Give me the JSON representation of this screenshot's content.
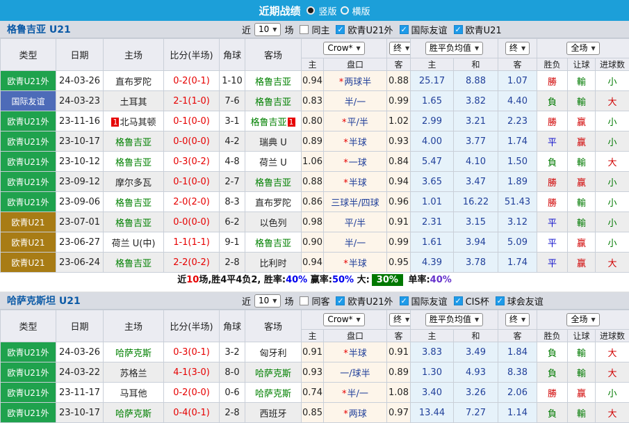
{
  "topbar": {
    "title": "近期战绩",
    "radio_vertical": "竖版",
    "radio_horizontal": "横版"
  },
  "columns": {
    "col_type": "类型",
    "col_date": "日期",
    "col_home": "主场",
    "col_score": "比分(半场)",
    "col_corner": "角球",
    "col_away": "客场",
    "dd_bookmaker": "Crow*",
    "dd_end1": "终",
    "dd_wdl_mean": "胜平负均值",
    "dd_end2": "终",
    "dd_scope": "全场",
    "sub": [
      "主",
      "盘口",
      "客",
      "主",
      "和",
      "客",
      "胜负",
      "让球",
      "进球数"
    ]
  },
  "colors": {
    "topbar_bg": "#1C9FD9",
    "team_title_blue": "#0C5AA6",
    "badge_green": "#1FA24D",
    "badge_blue": "#4D6BB8",
    "badge_brown": "#A87C15",
    "team_green": "#008000",
    "score_red": "#E60000",
    "handicap_navy": "#21409A",
    "result_red": "#D00000",
    "result_green": "#007A00",
    "result_blue": "#1414CC",
    "checkbox_blue": "#1E9BE9",
    "summary_box_green": "#007800"
  },
  "tables": [
    {
      "team": "格鲁吉亚 U21",
      "filter": {
        "near_label": "近",
        "matches_value": "10",
        "matches_label": "场",
        "same_label": "同主",
        "comps": [
          "欧青U21外",
          "国际友谊",
          "欧青U21"
        ]
      },
      "rows": [
        {
          "type": "欧青U21外",
          "type_color": "green",
          "date": "24-03-26",
          "home": "直布罗陀",
          "home_green": false,
          "home_mark": "",
          "score": "0-2(0-1)",
          "corner": "1-10",
          "away": "格鲁吉亚",
          "away_green": true,
          "away_mark": "",
          "o1": "0.94",
          "hc_star": true,
          "hc": "两球半",
          "o2": "0.88",
          "m1": "25.17",
          "m2": "8.88",
          "m3": "1.07",
          "r1": "勝",
          "r1c": "red",
          "r2": "輸",
          "r2c": "green",
          "r3": "小",
          "r3c": "green"
        },
        {
          "type": "国际友谊",
          "type_color": "blue",
          "date": "24-03-23",
          "home": "土耳其",
          "home_green": false,
          "home_mark": "",
          "score": "2-1(1-0)",
          "corner": "7-6",
          "away": "格鲁吉亚",
          "away_green": true,
          "away_mark": "",
          "o1": "0.83",
          "hc_star": false,
          "hc": "半/一",
          "o2": "0.99",
          "m1": "1.65",
          "m2": "3.82",
          "m3": "4.40",
          "r1": "負",
          "r1c": "green",
          "r2": "輸",
          "r2c": "green",
          "r3": "大",
          "r3c": "red"
        },
        {
          "type": "欧青U21外",
          "type_color": "green",
          "date": "23-11-16",
          "home": "北马其顿",
          "home_green": false,
          "home_mark": "1",
          "score": "0-1(0-0)",
          "corner": "3-1",
          "away": "格鲁吉亚",
          "away_green": true,
          "away_mark": "1",
          "o1": "0.80",
          "hc_star": true,
          "hc": "平/半",
          "o2": "1.02",
          "m1": "2.99",
          "m2": "3.21",
          "m3": "2.23",
          "r1": "勝",
          "r1c": "red",
          "r2": "赢",
          "r2c": "red",
          "r3": "小",
          "r3c": "green"
        },
        {
          "type": "欧青U21外",
          "type_color": "green",
          "date": "23-10-17",
          "home": "格鲁吉亚",
          "home_green": true,
          "home_mark": "",
          "score": "0-0(0-0)",
          "corner": "4-2",
          "away": "瑞典 U",
          "away_green": false,
          "away_mark": "",
          "o1": "0.89",
          "hc_star": true,
          "hc": "半球",
          "o2": "0.93",
          "m1": "4.00",
          "m2": "3.77",
          "m3": "1.74",
          "r1": "平",
          "r1c": "blue",
          "r2": "赢",
          "r2c": "red",
          "r3": "小",
          "r3c": "green"
        },
        {
          "type": "欧青U21外",
          "type_color": "green",
          "date": "23-10-12",
          "home": "格鲁吉亚",
          "home_green": true,
          "home_mark": "",
          "score": "0-3(0-2)",
          "corner": "4-8",
          "away": "荷兰 U",
          "away_green": false,
          "away_mark": "",
          "o1": "1.06",
          "hc_star": true,
          "hc": "一球",
          "o2": "0.84",
          "m1": "5.47",
          "m2": "4.10",
          "m3": "1.50",
          "r1": "負",
          "r1c": "green",
          "r2": "輸",
          "r2c": "green",
          "r3": "大",
          "r3c": "red"
        },
        {
          "type": "欧青U21外",
          "type_color": "green",
          "date": "23-09-12",
          "home": "摩尔多瓦",
          "home_green": false,
          "home_mark": "",
          "score": "0-1(0-0)",
          "corner": "2-7",
          "away": "格鲁吉亚",
          "away_green": true,
          "away_mark": "",
          "o1": "0.88",
          "hc_star": true,
          "hc": "半球",
          "o2": "0.94",
          "m1": "3.65",
          "m2": "3.47",
          "m3": "1.89",
          "r1": "勝",
          "r1c": "red",
          "r2": "赢",
          "r2c": "red",
          "r3": "小",
          "r3c": "green"
        },
        {
          "type": "欧青U21外",
          "type_color": "green",
          "date": "23-09-06",
          "home": "格鲁吉亚",
          "home_green": true,
          "home_mark": "",
          "score": "2-0(2-0)",
          "corner": "8-3",
          "away": "直布罗陀",
          "away_green": false,
          "away_mark": "",
          "o1": "0.86",
          "hc_star": false,
          "hc": "三球半/四球",
          "o2": "0.96",
          "m1": "1.01",
          "m2": "16.22",
          "m3": "51.43",
          "r1": "勝",
          "r1c": "red",
          "r2": "輸",
          "r2c": "green",
          "r3": "小",
          "r3c": "green"
        },
        {
          "type": "欧青U21",
          "type_color": "brown",
          "date": "23-07-01",
          "home": "格鲁吉亚",
          "home_green": true,
          "home_mark": "",
          "score": "0-0(0-0)",
          "corner": "6-2",
          "away": "以色列",
          "away_green": false,
          "away_mark": "",
          "o1": "0.98",
          "hc_star": false,
          "hc": "平/半",
          "o2": "0.91",
          "m1": "2.31",
          "m2": "3.15",
          "m3": "3.12",
          "r1": "平",
          "r1c": "blue",
          "r2": "輸",
          "r2c": "green",
          "r3": "小",
          "r3c": "green"
        },
        {
          "type": "欧青U21",
          "type_color": "brown",
          "date": "23-06-27",
          "home": "荷兰 U(中)",
          "home_green": false,
          "home_mark": "",
          "score": "1-1(1-1)",
          "corner": "9-1",
          "away": "格鲁吉亚",
          "away_green": true,
          "away_mark": "",
          "o1": "0.90",
          "hc_star": false,
          "hc": "半/一",
          "o2": "0.99",
          "m1": "1.61",
          "m2": "3.94",
          "m3": "5.09",
          "r1": "平",
          "r1c": "blue",
          "r2": "赢",
          "r2c": "red",
          "r3": "小",
          "r3c": "green"
        },
        {
          "type": "欧青U21",
          "type_color": "brown",
          "date": "23-06-24",
          "home": "格鲁吉亚",
          "home_green": true,
          "home_mark": "",
          "score": "2-2(0-2)",
          "corner": "2-8",
          "away": "比利时",
          "away_green": false,
          "away_mark": "",
          "o1": "0.94",
          "hc_star": true,
          "hc": "半球",
          "o2": "0.95",
          "m1": "4.39",
          "m2": "3.78",
          "m3": "1.74",
          "r1": "平",
          "r1c": "blue",
          "r2": "赢",
          "r2c": "red",
          "r3": "大",
          "r3c": "red"
        }
      ],
      "summary": {
        "p1": "近",
        "p2": "10",
        "p3": "场,胜4平4负2, 胜率:",
        "p4": "40%",
        "p5": "赢率:",
        "p6": "50%",
        "p7": "大:",
        "p8": "30%",
        "p9": "单率:",
        "p10": "40%"
      }
    },
    {
      "team": "哈萨克斯坦 U21",
      "filter": {
        "near_label": "近",
        "matches_value": "10",
        "matches_label": "场",
        "same_label": "同客",
        "comps": [
          "欧青U21外",
          "国际友谊",
          "CIS杯",
          "球会友谊"
        ]
      },
      "rows": [
        {
          "type": "欧青U21外",
          "type_color": "green",
          "date": "24-03-26",
          "home": "哈萨克斯",
          "home_green": true,
          "home_mark": "",
          "score": "0-3(0-1)",
          "corner": "3-2",
          "away": "匈牙利",
          "away_green": false,
          "away_mark": "",
          "o1": "0.91",
          "hc_star": true,
          "hc": "半球",
          "o2": "0.91",
          "m1": "3.83",
          "m2": "3.49",
          "m3": "1.84",
          "r1": "負",
          "r1c": "green",
          "r2": "輸",
          "r2c": "green",
          "r3": "大",
          "r3c": "red"
        },
        {
          "type": "欧青U21外",
          "type_color": "green",
          "date": "24-03-22",
          "home": "苏格兰",
          "home_green": false,
          "home_mark": "",
          "score": "4-1(3-0)",
          "corner": "8-0",
          "away": "哈萨克斯",
          "away_green": true,
          "away_mark": "",
          "o1": "0.93",
          "hc_star": false,
          "hc": "一/球半",
          "o2": "0.89",
          "m1": "1.30",
          "m2": "4.93",
          "m3": "8.38",
          "r1": "負",
          "r1c": "green",
          "r2": "輸",
          "r2c": "green",
          "r3": "大",
          "r3c": "red"
        },
        {
          "type": "欧青U21外",
          "type_color": "green",
          "date": "23-11-17",
          "home": "马耳他",
          "home_green": false,
          "home_mark": "",
          "score": "0-2(0-0)",
          "corner": "0-6",
          "away": "哈萨克斯",
          "away_green": true,
          "away_mark": "",
          "o1": "0.74",
          "hc_star": true,
          "hc": "半/一",
          "o2": "1.08",
          "m1": "3.40",
          "m2": "3.26",
          "m3": "2.06",
          "r1": "勝",
          "r1c": "red",
          "r2": "赢",
          "r2c": "red",
          "r3": "小",
          "r3c": "green"
        },
        {
          "type": "欧青U21外",
          "type_color": "green",
          "date": "23-10-17",
          "home": "哈萨克斯",
          "home_green": true,
          "home_mark": "",
          "score": "0-4(0-1)",
          "corner": "2-8",
          "away": "西班牙",
          "away_green": false,
          "away_mark": "",
          "o1": "0.85",
          "hc_star": true,
          "hc": "两球",
          "o2": "0.97",
          "m1": "13.44",
          "m2": "7.27",
          "m3": "1.14",
          "r1": "負",
          "r1c": "green",
          "r2": "輸",
          "r2c": "green",
          "r3": "大",
          "r3c": "red"
        }
      ]
    }
  ]
}
